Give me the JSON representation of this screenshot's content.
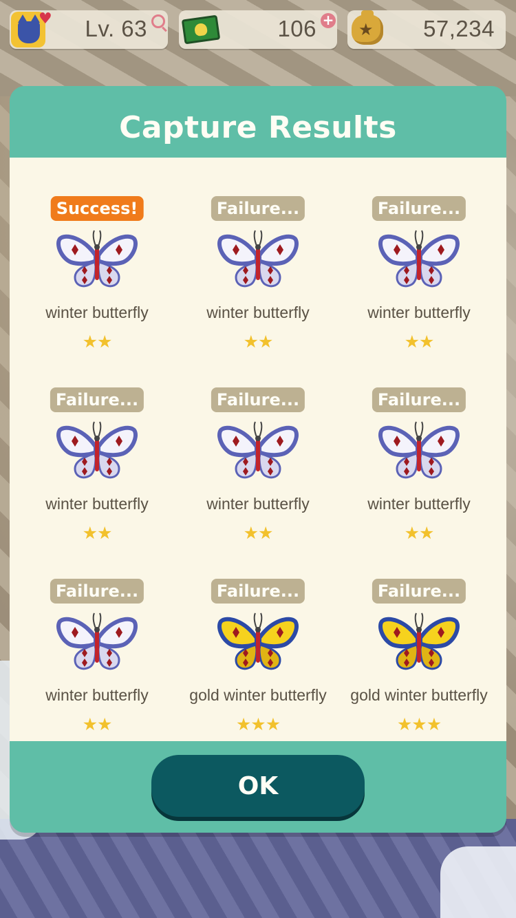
{
  "hud": {
    "level": "Lv. 63",
    "tickets": "106",
    "bells": "57,234"
  },
  "modal": {
    "title": "Capture Results",
    "ok_label": "OK"
  },
  "results": [
    {
      "status": "Success!",
      "type": "success",
      "name": "winter butterfly",
      "stars": "★★",
      "variant": "winter"
    },
    {
      "status": "Failure...",
      "type": "failure",
      "name": "winter butterfly",
      "stars": "★★",
      "variant": "winter"
    },
    {
      "status": "Failure...",
      "type": "failure",
      "name": "winter butterfly",
      "stars": "★★",
      "variant": "winter"
    },
    {
      "status": "Failure...",
      "type": "failure",
      "name": "winter butterfly",
      "stars": "★★",
      "variant": "winter"
    },
    {
      "status": "Failure...",
      "type": "failure",
      "name": "winter butterfly",
      "stars": "★★",
      "variant": "winter"
    },
    {
      "status": "Failure...",
      "type": "failure",
      "name": "winter butterfly",
      "stars": "★★",
      "variant": "winter"
    },
    {
      "status": "Failure...",
      "type": "failure",
      "name": "winter butterfly",
      "stars": "★★",
      "variant": "winter"
    },
    {
      "status": "Failure...",
      "type": "failure",
      "name": "gold winter butterfly",
      "stars": "★★★",
      "variant": "gold"
    },
    {
      "status": "Failure...",
      "type": "failure",
      "name": "gold winter butterfly",
      "stars": "★★★",
      "variant": "gold"
    }
  ],
  "colors": {
    "modal_frame": "#5fbea7",
    "modal_body": "#fbf7e7",
    "success_badge": "#f07b1b",
    "failure_badge": "#bdb192",
    "star": "#f2c12d",
    "ok_button": "#0c5960"
  }
}
